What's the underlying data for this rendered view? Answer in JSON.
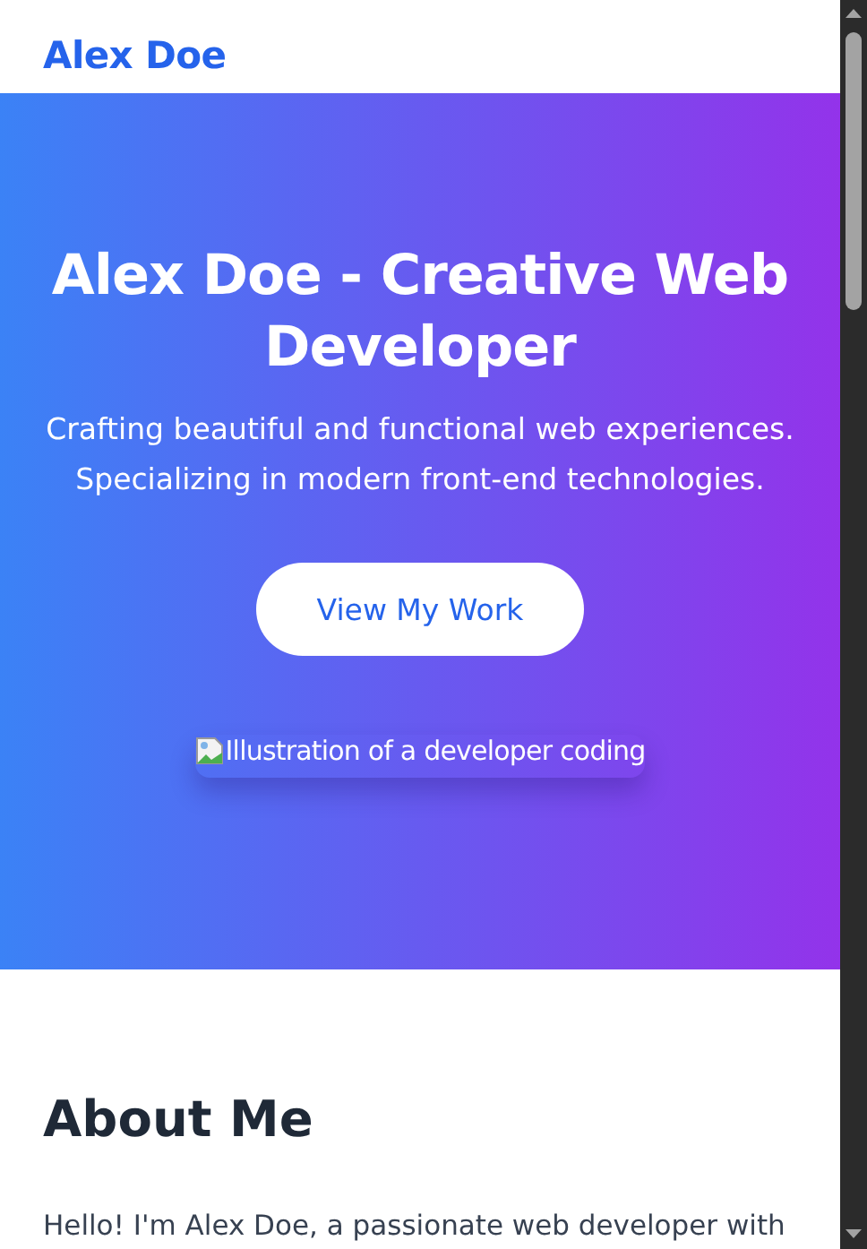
{
  "header": {
    "logo": "Alex Doe"
  },
  "hero": {
    "title": "Alex Doe - Creative Web Developer",
    "subtitle": "Crafting beautiful and functional web experiences. Specializing in modern front-end technologies.",
    "button": "View My Work",
    "image_alt": "Illustration of a developer coding"
  },
  "about": {
    "heading": "About Me",
    "paragraph": "Hello! I'm Alex Doe, a passionate web developer with"
  }
}
